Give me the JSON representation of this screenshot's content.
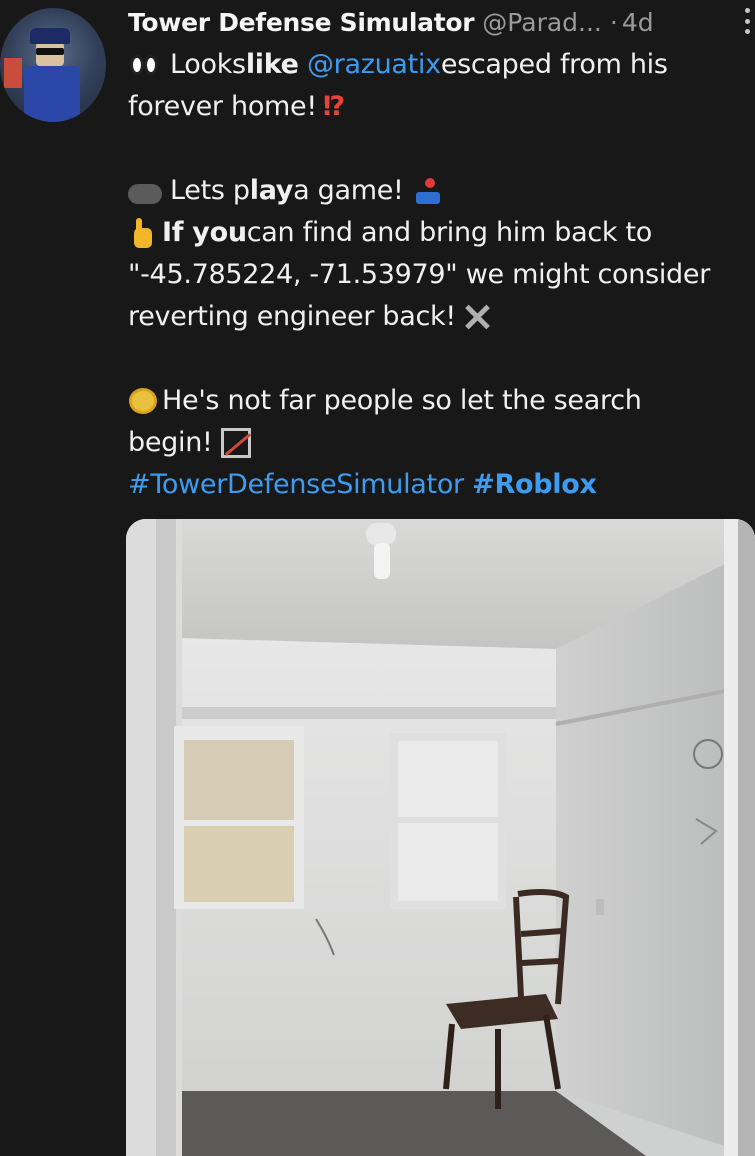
{
  "tweet": {
    "author_name": "Tower Defense Simulator",
    "author_handle": "@Parad...",
    "separator": "·",
    "time": "4d",
    "line1_a": "Looks ",
    "line1_b": "like",
    "line1_mention": "@razuatix",
    "line1_c": " escaped from his",
    "line2": "forever home!",
    "line2_icon": "⁉",
    "line4_a": "Lets p",
    "line4_b": "lay",
    "line4_c": " a game!",
    "line5_a": "If you",
    "line5_b": " can find and bring him back to",
    "line6": "\"-45.785224, -71.53979\" we might consider",
    "line7": "reverting engineer back!",
    "line9": "He's not far people so let the search",
    "line10": "begin!",
    "hashtag1": "#TowerDefenseSimulator",
    "hashtag2": "#Roblox"
  },
  "icons": {
    "avatar": "avatar-image",
    "line1": "eyes-icon",
    "line4_start": "gamepad-icon",
    "line4_end": "joystick-icon",
    "line5": "pointing-hand-icon",
    "line7": "hammer-wrench-icon",
    "line9": "virus-icon",
    "line10": "bow-arrow-icon",
    "more": "more-options-icon"
  },
  "colors": {
    "background": "#181818",
    "link": "#3d9bf0",
    "muted": "#9a9a9a"
  }
}
